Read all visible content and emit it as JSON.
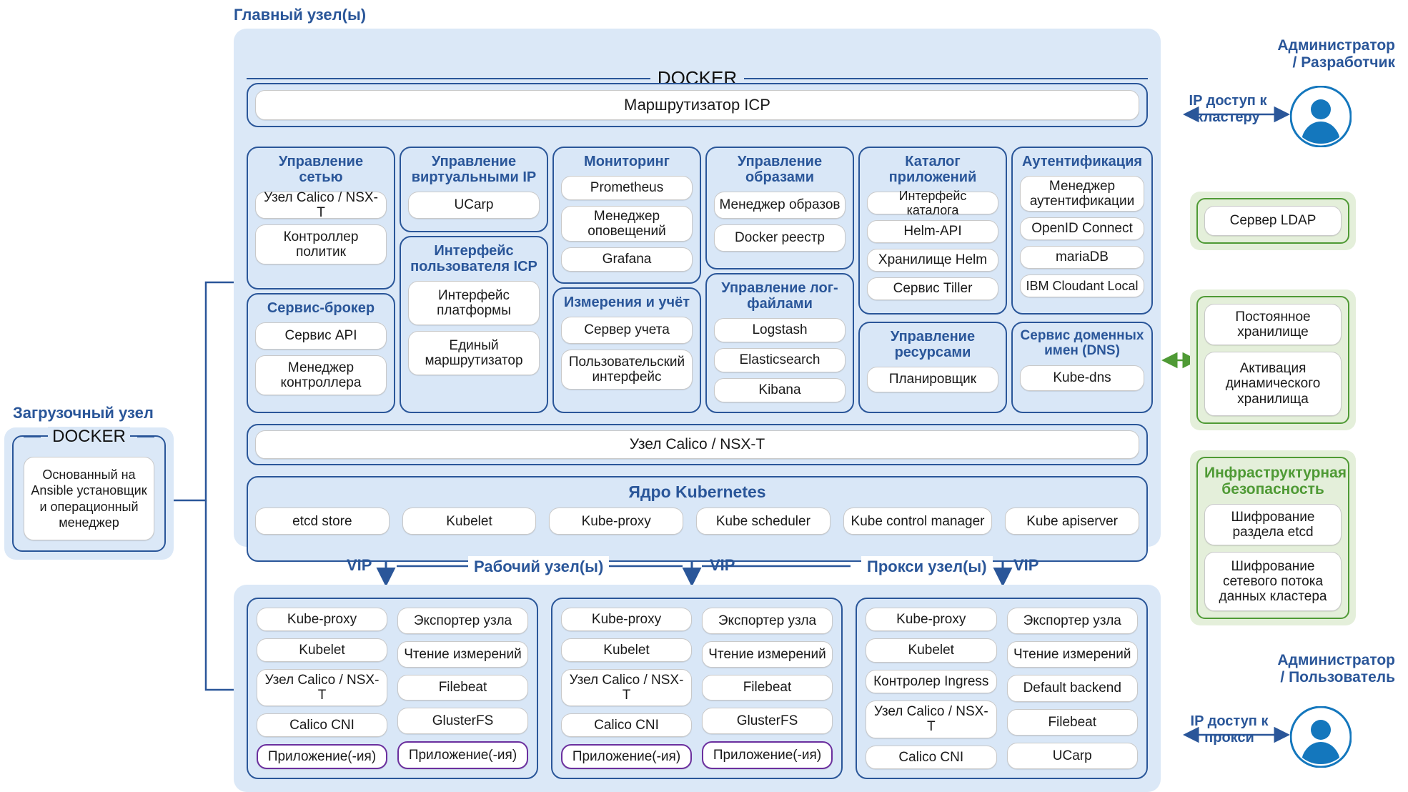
{
  "labels": {
    "master_nodes": "Главный узел(ы)",
    "boot_node": "Загрузочный узел",
    "worker_nodes": "Рабочий узел(ы)",
    "proxy_nodes": "Прокси узел(ы)",
    "docker": "DOCKER",
    "vip": "VIP",
    "vip2": "VIP",
    "vip3": "VIP"
  },
  "colors": {
    "accent_blue": "#2a5699",
    "panel_blue": "#dbe8f7",
    "group_blue": "#d9e7f7",
    "green": "#4f9a35",
    "green_bg": "#e4efda",
    "purple": "#6b2f9e",
    "avatar_blue": "#1477bd"
  },
  "master": {
    "router": "Маршрутизатор ICP",
    "calico_bar": "Узел Calico / NSX-T",
    "groups": [
      {
        "title": "Управление сетью",
        "items": [
          "Узел Calico / NSX-T",
          "Контроллер политик"
        ]
      },
      {
        "title": "Сервис-брокер",
        "items": [
          "Сервис API",
          "Менеджер контроллера"
        ]
      },
      {
        "title": "Управление виртуальными IP",
        "items": [
          "UCarp"
        ]
      },
      {
        "title": "Интерфейс пользователя ICP",
        "items": [
          "Интерфейс платформы",
          "Единый маршрутизатор"
        ]
      },
      {
        "title": "Мониторинг",
        "items": [
          "Prometheus",
          "Менеджер оповещений",
          "Grafana"
        ]
      },
      {
        "title": "Измерения и учёт",
        "items": [
          "Сервер учета",
          "Пользовательский интерфейс"
        ]
      },
      {
        "title": "Управление образами",
        "items": [
          "Менеджер образов",
          "Docker реестр"
        ]
      },
      {
        "title": "Управление лог-файлами",
        "items": [
          "Logstash",
          "Elasticsearch",
          "Kibana"
        ]
      },
      {
        "title": "Каталог приложений",
        "items": [
          "Интерфейс каталога",
          "Helm-API",
          "Хранилище Helm",
          "Сервис Tiller"
        ]
      },
      {
        "title": "Управление ресурсами",
        "items": [
          "Планировщик"
        ]
      },
      {
        "title": "Аутентификация",
        "items": [
          "Менеджер аутентификации",
          "OpenID Connect",
          "mariaDB",
          "IBM Cloudant Local"
        ]
      },
      {
        "title": "Сервис доменных имен (DNS)",
        "items": [
          "Kube-dns"
        ]
      }
    ],
    "kube_core": {
      "title": "Ядро Kubernetes",
      "items": [
        "etcd store",
        "Kubelet",
        "Kube-proxy",
        "Kube scheduler",
        "Kube control manager",
        "Kube apiserver"
      ]
    }
  },
  "boot": {
    "docker": "DOCKER",
    "item": "Основанный на Ansible установщик и операционный менеджер"
  },
  "worker_cards": [
    {
      "left": [
        "Kube-proxy",
        "Kubelet",
        "Узел Calico / NSX-T",
        "Calico CNI",
        "Приложение(-ия)"
      ],
      "right": [
        "Экспортер узла",
        "Чтение измерений",
        "Filebeat",
        "GlusterFS",
        "Приложение(-ия)"
      ],
      "app_rows": [
        4
      ]
    },
    {
      "left": [
        "Kube-proxy",
        "Kubelet",
        "Узел Calico / NSX-T",
        "Calico CNI",
        "Приложение(-ия)"
      ],
      "right": [
        "Экспортер узла",
        "Чтение измерений",
        "Filebeat",
        "GlusterFS",
        "Приложение(-ия)"
      ],
      "app_rows": [
        4
      ]
    },
    {
      "left": [
        "Kube-proxy",
        "Kubelet",
        "Контролер Ingress",
        "Узел Calico / NSX-T",
        "Calico CNI"
      ],
      "right": [
        "Экспортер узла",
        "Чтение измерений",
        "Default backend",
        "Filebeat",
        "UCarp"
      ],
      "app_rows": []
    }
  ],
  "right_side": {
    "admin_dev_label": "Администратор / Разработчик",
    "admin_dev_arrow": "IP доступ к кластеру",
    "admin_user_label": "Администратор / Пользователь",
    "admin_user_arrow": "IP доступ к прокси",
    "ldap": {
      "items": [
        "Сервер LDAP"
      ]
    },
    "storage": {
      "items": [
        "Постоянное хранилище",
        "Активация динамического хранилища"
      ]
    },
    "security": {
      "title": "Инфраструктурная безопасность",
      "items": [
        "Шифрование раздела etcd",
        "Шифрование сетевого потока данных кластера"
      ]
    }
  }
}
